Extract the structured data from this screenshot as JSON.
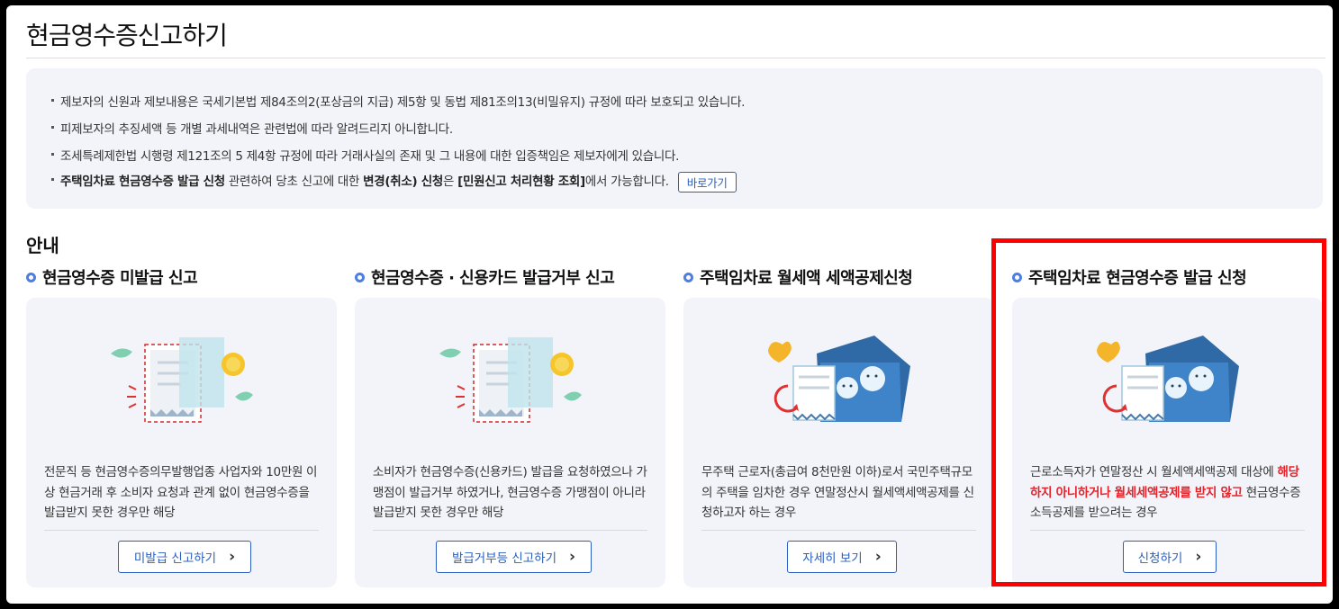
{
  "page": {
    "title": "현금영수증신고하기",
    "guide_title": "안내"
  },
  "notice": {
    "line1": "제보자의 신원과 제보내용은 국세기본법 제84조의2(포상금의 지급) 제5항 및 동법 제81조의13(비밀유지) 규정에 따라 보호되고 있습니다.",
    "line2": "피제보자의 추징세액 등 개별 과세내역은 관련법에 따라 알려드리지 아니합니다.",
    "line3": "조세특례제한법 시행령 제121조의 5 제4항 규정에 따라 거래사실의 존재 및 그 내용에 대한 입증책임은 제보자에게 있습니다.",
    "line4": {
      "part1": "주택임차료 현금영수증 발급 신청",
      "part2": " 관련하여 당초 신고에 대한 ",
      "part3": "변경(취소) 신청",
      "part4": "은 ",
      "part5": "[민원신고 처리현황 조회]",
      "part6": "에서 가능합니다.",
      "button": "바로가기"
    }
  },
  "cards": [
    {
      "heading": "현금영수증 미발급 신고",
      "text": "전문직 등 현금영수증의무발행업종 사업자와 10만원 이상 현금거래 후 소비자 요청과 관계 없이 현금영수증을 발급받지 못한 경우만 해당",
      "button": "미발급 신고하기",
      "icon": "receipt-illustration-icon"
    },
    {
      "heading": "현금영수증 · 신용카드 발급거부 신고",
      "text": "소비자가 현금영수증(신용카드) 발급을 요청하였으나 가맹점이 발급거부 하였거나, 현금영수증 가맹점이 아니라 발급받지 못한 경우만 해당",
      "button": "발급거부등 신고하기",
      "icon": "receipt-illustration-icon"
    },
    {
      "heading": "주택임차료 월세액 세액공제신청",
      "text": "무주택 근로자(총급여 8천만원 이하)로서 국민주택규모의 주택을 임차한 경우 연말정산시 월세액세액공제를 신청하고자 하는 경우",
      "button": "자세히 보기",
      "icon": "rent-illustration-icon"
    },
    {
      "heading": "주택임차료 현금영수증 발급 신청",
      "text_part1": "근로소득자가 연말정산 시 월세액세액공제 대상에 ",
      "text_red": "해당하지 아니하거나 월세세액공제를 받지 않고",
      "text_part2": " 현금영수증 소득공제를 받으려는 경우",
      "button": "신청하기",
      "icon": "rent-illustration-icon"
    }
  ],
  "colors": {
    "accent": "#2b5fbf",
    "highlight": "#ff0000",
    "emphasis": "#e4232b",
    "panel": "#f2f4f9"
  }
}
